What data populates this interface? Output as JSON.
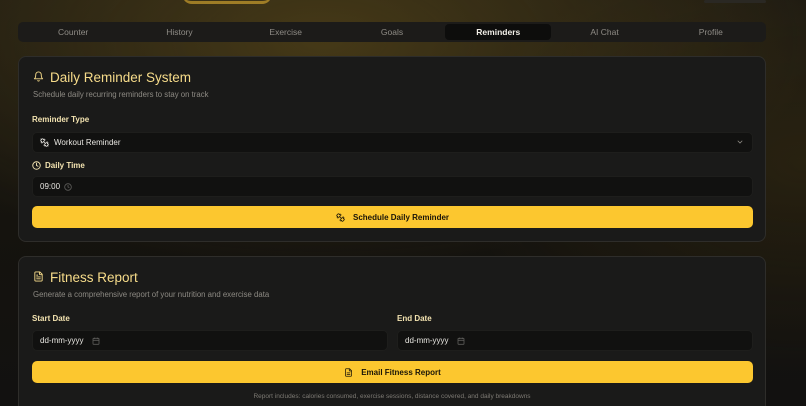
{
  "tabs": [
    {
      "label": "Counter"
    },
    {
      "label": "History"
    },
    {
      "label": "Exercise"
    },
    {
      "label": "Goals"
    },
    {
      "label": "Reminders",
      "active": true
    },
    {
      "label": "AI Chat"
    },
    {
      "label": "Profile"
    }
  ],
  "reminder": {
    "title": "Daily Reminder System",
    "subtitle": "Schedule daily recurring reminders to stay on track",
    "type_label": "Reminder Type",
    "type_value": "Workout Reminder",
    "time_label": "Daily Time",
    "time_value": "09:00",
    "button_label": "Schedule Daily Reminder"
  },
  "report": {
    "title": "Fitness Report",
    "subtitle": "Generate a comprehensive report of your nutrition and exercise data",
    "start_label": "Start Date",
    "start_placeholder": "dd-mm-yyyy",
    "end_label": "End Date",
    "end_placeholder": "dd-mm-yyyy",
    "button_label": "Email Fitness Report",
    "footnote": "Report includes: calories consumed, exercise sessions, distance covered, and daily breakdowns"
  },
  "colors": {
    "accent": "#fcc72f",
    "title": "#f7dc8a",
    "card_bg": "#1a1a19"
  },
  "icons": {
    "reminder_title": "bell-icon",
    "reminder_type": "dumbbell-icon",
    "time": "clock-icon",
    "schedule_button": "dumbbell-icon",
    "report_title": "document-icon",
    "email_button": "document-icon",
    "select": "chevron-down-icon",
    "calendar": "calendar-icon"
  }
}
